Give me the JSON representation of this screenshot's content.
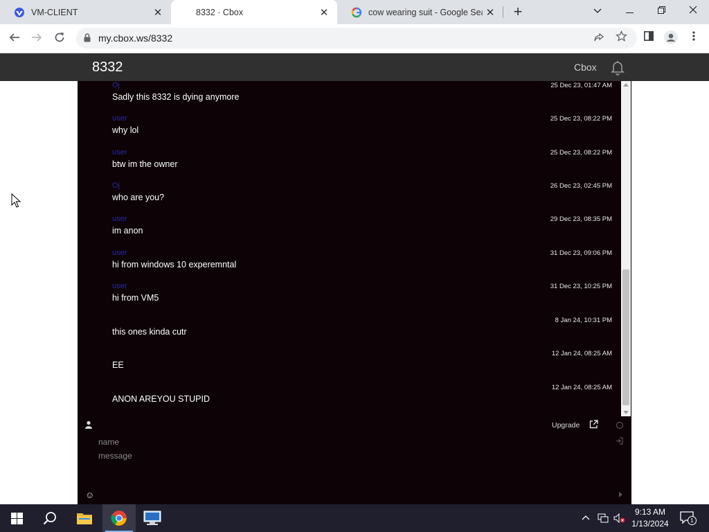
{
  "browser": {
    "tabs": [
      {
        "title": "VM-CLIENT",
        "favicon": "vm-client-icon",
        "active": false
      },
      {
        "title": "8332 · Cbox",
        "favicon": "none",
        "active": true
      },
      {
        "title": "cow wearing suit - Google Search",
        "favicon": "google-icon",
        "active": false
      }
    ],
    "url": "my.cbox.ws/8332"
  },
  "cbox": {
    "title": "8332",
    "brand": "Cbox",
    "messages": [
      {
        "author": "Oj",
        "time": "25 Dec 23, 01:47 AM",
        "text": "Sadly this 8332 is dying anymore"
      },
      {
        "author": "user",
        "time": "25 Dec 23, 08:22 PM",
        "text": "why lol"
      },
      {
        "author": "user",
        "time": "25 Dec 23, 08:22 PM",
        "text": "btw im the owner"
      },
      {
        "author": "Oj",
        "time": "26 Dec 23, 02:45 PM",
        "text": "who are you?"
      },
      {
        "author": "user",
        "time": "29 Dec 23, 08:35 PM",
        "text": "im anon"
      },
      {
        "author": "user",
        "time": "31 Dec 23, 09:06 PM",
        "text": "hi from windows 10 experemntal"
      },
      {
        "author": "user",
        "time": "31 Dec 23, 10:25 PM",
        "text": "hi from VM5"
      },
      {
        "author": "",
        "time": "8 Jan 24, 10:31 PM",
        "text": "this ones kinda cutr"
      },
      {
        "author": "",
        "time": "12 Jan 24, 08:25 AM",
        "text": "EE"
      },
      {
        "author": "",
        "time": "12 Jan 24, 08:25 AM",
        "text": "ANON AREYOU STUPID"
      }
    ],
    "form": {
      "upgrade_label": "Upgrade",
      "name_placeholder": "name",
      "message_placeholder": "message"
    }
  },
  "taskbar": {
    "time": "9:13 AM",
    "date": "1/13/2024",
    "notification_count": "1",
    "items": [
      "start-button",
      "search-button",
      "file-explorer",
      "chrome",
      "remote-desktop"
    ]
  },
  "colors": {
    "cbox_background": "#0d0205",
    "header_background": "#303030",
    "author_color": "#2a2aa8",
    "taskbar_background": "#1f1f2e"
  }
}
